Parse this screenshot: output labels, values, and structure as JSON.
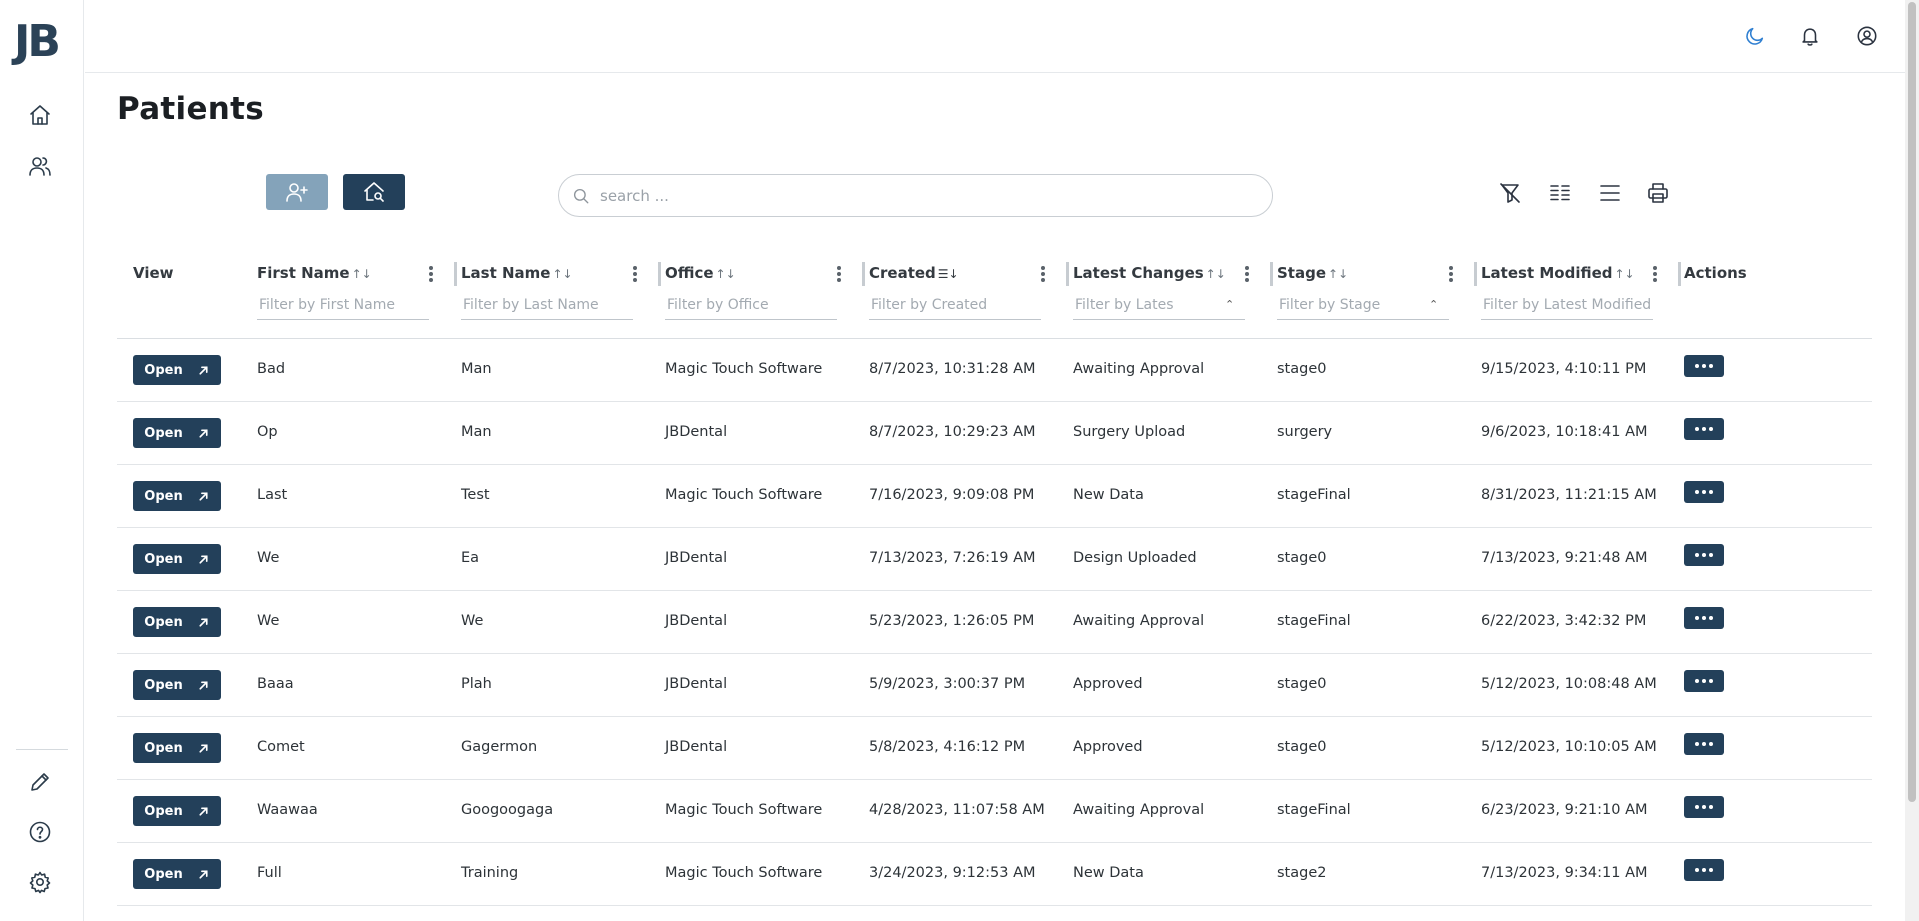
{
  "logo": "JB",
  "page_title": "Patients",
  "search": {
    "placeholder": "search ..."
  },
  "columns": [
    {
      "key": "view",
      "label": "View"
    },
    {
      "key": "first",
      "label": "First Name",
      "filter": "Filter by First Name"
    },
    {
      "key": "last",
      "label": "Last Name",
      "filter": "Filter by Last Name"
    },
    {
      "key": "office",
      "label": "Office",
      "filter": "Filter by Office"
    },
    {
      "key": "created",
      "label": "Created",
      "filter": "Filter by Created"
    },
    {
      "key": "changes",
      "label": "Latest Changes",
      "filter": "Filter by Lates"
    },
    {
      "key": "stage",
      "label": "Stage",
      "filter": "Filter by Stage"
    },
    {
      "key": "modified",
      "label": "Latest Modified",
      "filter": "Filter by Latest Modified"
    },
    {
      "key": "actions",
      "label": "Actions"
    }
  ],
  "open_label": "Open",
  "rows": [
    {
      "first": "Bad",
      "last": "Man",
      "office": "Magic Touch Software",
      "created": "8/7/2023, 10:31:28 AM",
      "changes": "Awaiting Approval",
      "stage": "stage0",
      "modified": "9/15/2023, 4:10:11 PM"
    },
    {
      "first": "Op",
      "last": "Man",
      "office": "JBDental",
      "created": "8/7/2023, 10:29:23 AM",
      "changes": "Surgery Upload",
      "stage": "surgery",
      "modified": "9/6/2023, 10:18:41 AM"
    },
    {
      "first": "Last",
      "last": "Test",
      "office": "Magic Touch Software",
      "created": "7/16/2023, 9:09:08 PM",
      "changes": "New Data",
      "stage": "stageFinal",
      "modified": "8/31/2023, 11:21:15 AM"
    },
    {
      "first": "We",
      "last": "Ea",
      "office": "JBDental",
      "created": "7/13/2023, 7:26:19 AM",
      "changes": "Design Uploaded",
      "stage": "stage0",
      "modified": "7/13/2023, 9:21:48 AM"
    },
    {
      "first": "We",
      "last": "We",
      "office": "JBDental",
      "created": "5/23/2023, 1:26:05 PM",
      "changes": "Awaiting Approval",
      "stage": "stageFinal",
      "modified": "6/22/2023, 3:42:32 PM"
    },
    {
      "first": "Baaa",
      "last": "Plah",
      "office": "JBDental",
      "created": "5/9/2023, 3:00:37 PM",
      "changes": "Approved",
      "stage": "stage0",
      "modified": "5/12/2023, 10:08:48 AM"
    },
    {
      "first": "Comet",
      "last": "Gagermon",
      "office": "JBDental",
      "created": "5/8/2023, 4:16:12 PM",
      "changes": "Approved",
      "stage": "stage0",
      "modified": "5/12/2023, 10:10:05 AM"
    },
    {
      "first": "Waawaa",
      "last": "Googoogaga",
      "office": "Magic Touch Software",
      "created": "4/28/2023, 11:07:58 AM",
      "changes": "Awaiting Approval",
      "stage": "stageFinal",
      "modified": "6/23/2023, 9:21:10 AM"
    },
    {
      "first": "Full",
      "last": "Training",
      "office": "Magic Touch Software",
      "created": "3/24/2023, 9:12:53 AM",
      "changes": "New Data",
      "stage": "stage2",
      "modified": "7/13/2023, 9:34:11 AM"
    }
  ],
  "colors": {
    "primary": "#23405a",
    "primary_light": "#84a3ba",
    "accent_moon": "#2f7fd1"
  },
  "icons": [
    "home-icon",
    "users-icon",
    "pencil-icon",
    "help-icon",
    "gear-icon",
    "moon-icon",
    "bell-icon",
    "user-circle-icon",
    "user-plus-icon",
    "home-search-icon",
    "search-icon",
    "filter-off-icon",
    "columns-icon",
    "rows-icon",
    "printer-icon"
  ]
}
